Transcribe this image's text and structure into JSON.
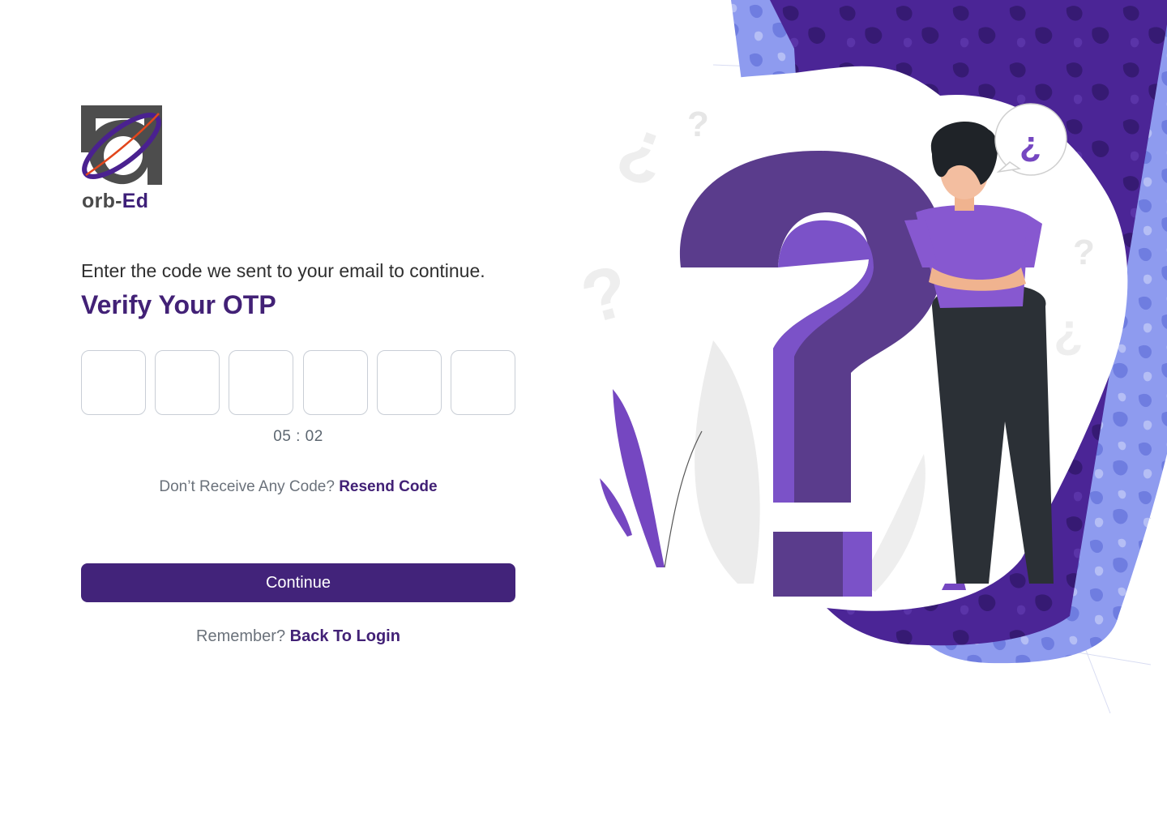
{
  "brand": {
    "logo_part1": "orb-",
    "logo_part2": "Ed",
    "logo_icon": "orb-ed-logo-icon"
  },
  "form": {
    "subtitle": "Enter the code we sent to your email to continue.",
    "title": "Verify Your OTP",
    "otp_digits": [
      "",
      "",
      "",
      "",
      "",
      ""
    ],
    "timer": "05 : 02",
    "resend_prompt": "Don’t Receive Any Code?",
    "resend_link": "Resend Code",
    "continue_label": "Continue",
    "back_prompt": "Remember?",
    "back_link": "Back To Login"
  },
  "illustration": {
    "speech_bubble_glyph": "¿",
    "icon": "confused-person-question-mark-illustration"
  },
  "colors": {
    "primary": "#422176",
    "button": "#42237a",
    "lavender": "#8e9bef",
    "purple_accent": "#7a4fc4",
    "text_muted": "#6b727b",
    "border": "#c9ced6"
  }
}
